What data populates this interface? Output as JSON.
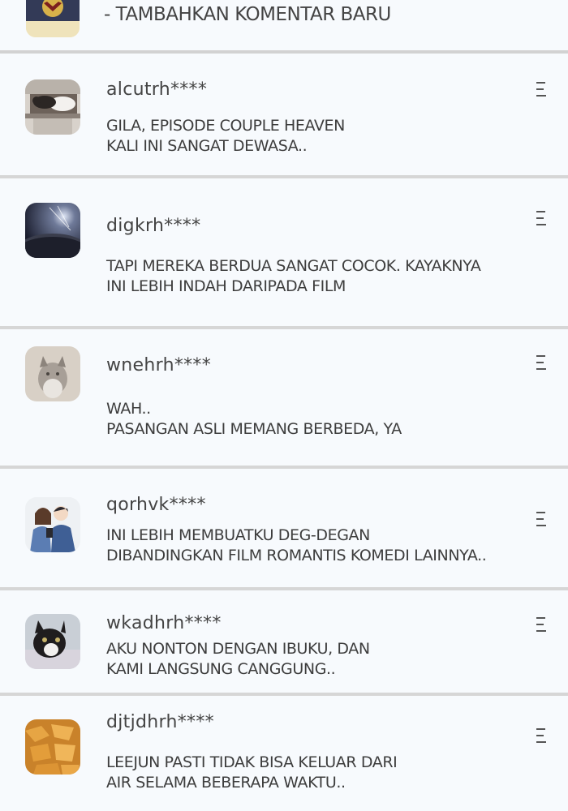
{
  "header": {
    "title": "- TAMBAHKAN KOMENTAR BARU",
    "avatar_icon": "badge-avatar"
  },
  "comments": [
    {
      "username": "alcutrh****",
      "lines": [
        "GILA, EPISODE COUPLE HEAVEN",
        "KALI INI SANGAT DEWASA.."
      ],
      "avatar": "cats-on-shelf"
    },
    {
      "username": "digkrh****",
      "lines": [
        "TAPI MEREKA BERDUA SANGAT COCOK. KAYAKNYA",
        "INI LEBIH INDAH DARIPADA FILM"
      ],
      "avatar": "planet-horizon"
    },
    {
      "username": "wnehrh****",
      "lines": [
        "WAH..",
        "PASANGAN ASLI MEMANG BERBEDA, YA"
      ],
      "avatar": "gray-cat"
    },
    {
      "username": "qorhvk****",
      "lines": [
        "INI LEBIH MEMBUATKU DEG-DEGAN",
        "DIBANDINGKAN FILM ROMANTIS KOMEDI LAINNYA.."
      ],
      "avatar": "illustrated-couple"
    },
    {
      "username": "wkadhrh****",
      "lines": [
        "AKU NONTON DENGAN IBUKU, DAN",
        "KAMI LANGSUNG CANGGUNG.."
      ],
      "avatar": "tuxedo-cat"
    },
    {
      "username": "djtjdhrh****",
      "lines": [
        "LEEJUN PASTI TIDAK BISA KELUAR DARI",
        "AIR SELAMA BEBERAPA WAKTU.."
      ],
      "avatar": "fried-snack"
    }
  ],
  "icons": {
    "menu": "more-menu-icon"
  },
  "colors": {
    "background": "#f7fafd",
    "divider": "#d6d6d6",
    "text": "#3d3d3d"
  }
}
